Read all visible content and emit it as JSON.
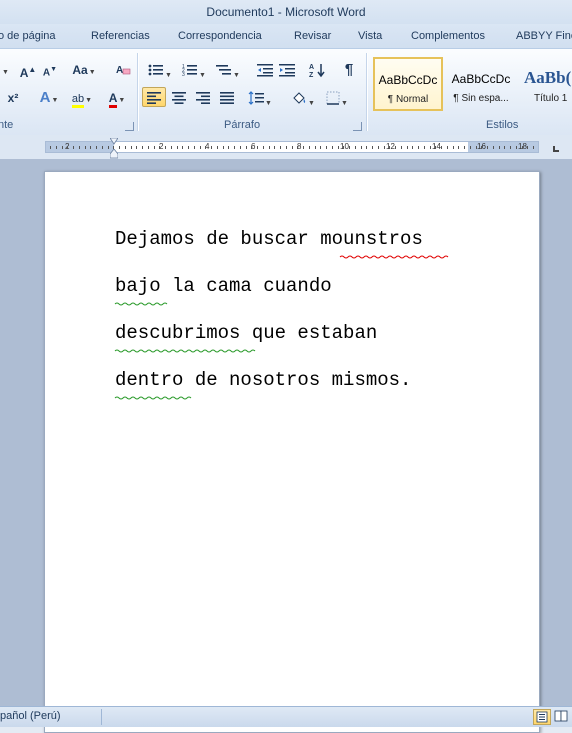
{
  "window": {
    "title": "Documento1  -  Microsoft Word"
  },
  "tabs": [
    "o de página",
    "Referencias",
    "Correspondencia",
    "Revisar",
    "Vista",
    "Complementos",
    "ABBYY Fine"
  ],
  "ribbon": {
    "font_group_label": "nte",
    "paragraph_group_label": "Párrafo",
    "styles_group_label": "Estilos",
    "font_buttons": {
      "grow_font": "A",
      "shrink_font": "A",
      "change_case": "Aa",
      "superscript": "x²",
      "text_effects": "A",
      "highlight": "ab",
      "font_color": "A"
    },
    "pilcrow": "¶",
    "styles": [
      {
        "preview": "AaBbCcDc",
        "name": "¶ Normal",
        "selected": true
      },
      {
        "preview": "AaBbCcDc",
        "name": "¶ Sin espa...",
        "selected": false
      },
      {
        "preview": "AaBb(",
        "name": "Título 1",
        "selected": false
      }
    ]
  },
  "ruler": {
    "labels": [
      "2",
      "2",
      "4",
      "6",
      "8",
      "10",
      "12",
      "14",
      "16",
      "18"
    ]
  },
  "document": {
    "lines": [
      "Dejamos de buscar mounstros",
      "bajo la cama cuando",
      "descubrimos que estaban",
      "dentro de nosotros mismos."
    ]
  },
  "statusbar": {
    "language": "pañol (Perú)"
  },
  "colors": {
    "accent": "#1e395b",
    "active_button": "#ffd66b",
    "font_color_underline": "#e00000",
    "highlight_underline": "#ffff00"
  }
}
